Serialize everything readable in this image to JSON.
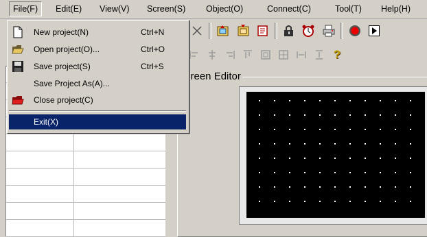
{
  "menubar": {
    "items": [
      "File(F)",
      "Edit(E)",
      "View(V)",
      "Screen(S)",
      "Object(O)",
      "Connect(C)",
      "Tool(T)",
      "Help(H)"
    ]
  },
  "file_menu": {
    "items": [
      {
        "label": "New project(N)",
        "shortcut": "Ctrl+N",
        "icon": "new-file-icon"
      },
      {
        "label": "Open project(O)...",
        "shortcut": "Ctrl+O",
        "icon": "open-folder-icon"
      },
      {
        "label": "Save project(S)",
        "shortcut": "Ctrl+S",
        "icon": "floppy-disk-icon"
      },
      {
        "label": "Save Project As(A)...",
        "shortcut": "",
        "icon": ""
      },
      {
        "label": "Close project(C)",
        "shortcut": "",
        "icon": "close-folder-icon"
      },
      {
        "label": "Exit(X)",
        "shortcut": "",
        "icon": ""
      }
    ]
  },
  "editor": {
    "title": "creen Editor"
  },
  "colors": {
    "menu_highlight": "#0a246a",
    "window_face": "#d4d0c8",
    "canvas": "#000000"
  }
}
